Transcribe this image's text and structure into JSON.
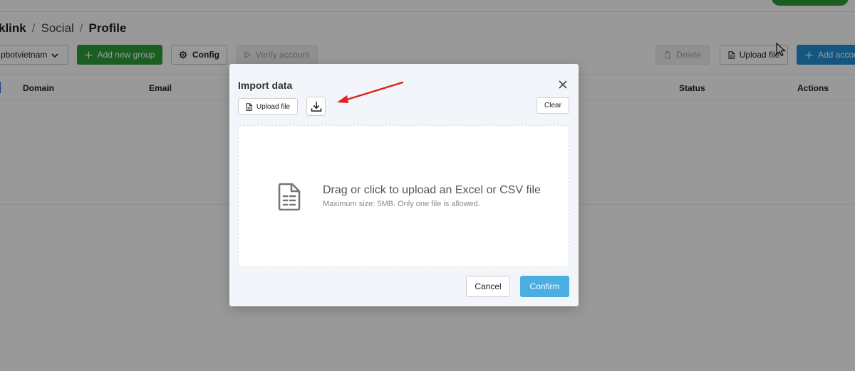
{
  "breadcrumb": {
    "root": "klink",
    "mid": "Social",
    "current": "Profile",
    "separator": "/"
  },
  "toolbar": {
    "account_select": "pbotvietnam",
    "add_group": "Add new group",
    "config": "Config",
    "verify": "Verify account",
    "delete": "Delete",
    "upload": "Upload file",
    "add_account": "Add accou"
  },
  "table": {
    "columns": {
      "domain": "Domain",
      "email": "Email",
      "status": "Status",
      "actions": "Actions"
    }
  },
  "modal": {
    "title": "Import data",
    "upload_label": "Upload file",
    "clear_label": "Clear",
    "dropzone_main": "Drag or click to upload an Excel or CSV file",
    "dropzone_sub": "Maximum size: 5MB. Only one file is allowed.",
    "cancel_label": "Cancel",
    "confirm_label": "Confirm"
  },
  "colors": {
    "green": "#2e9d3a",
    "blue": "#2192d8",
    "confirm": "#4aaee0",
    "annotation_arrow": "#e0201c"
  },
  "icons": {
    "chevron": "chevron-down-icon",
    "plus": "plus-icon",
    "gear": "gear-icon",
    "play": "play-icon",
    "trash": "trash-icon",
    "file": "file-icon",
    "download": "download-icon",
    "close": "close-icon",
    "spreadsheet": "spreadsheet-file-icon"
  }
}
